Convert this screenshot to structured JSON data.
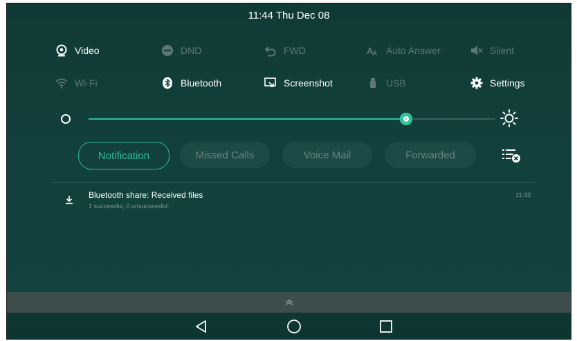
{
  "status": {
    "time": "11:44 Thu Dec 08"
  },
  "quick_settings": {
    "row1": [
      {
        "label": "Video",
        "icon": "video-icon",
        "enabled": true
      },
      {
        "label": "DND",
        "icon": "dnd-icon",
        "enabled": false
      },
      {
        "label": "FWD",
        "icon": "forward-icon",
        "enabled": false
      },
      {
        "label": "Auto Answer",
        "icon": "auto-answer-icon",
        "enabled": false
      },
      {
        "label": "Silent",
        "icon": "silent-icon",
        "enabled": false
      }
    ],
    "row2": [
      {
        "label": "Wi-Fi",
        "icon": "wifi-icon",
        "enabled": false
      },
      {
        "label": "Bluetooth",
        "icon": "bluetooth-icon",
        "enabled": true
      },
      {
        "label": "Screenshot",
        "icon": "screenshot-icon",
        "enabled": true
      },
      {
        "label": "USB",
        "icon": "usb-icon",
        "enabled": false
      },
      {
        "label": "Settings",
        "icon": "settings-icon",
        "enabled": true
      }
    ]
  },
  "brightness": {
    "level": 0.78
  },
  "tabs": [
    {
      "label": "Notification",
      "active": true
    },
    {
      "label": "Missed Calls",
      "active": false
    },
    {
      "label": "Voice Mail",
      "active": false
    },
    {
      "label": "Forwarded",
      "active": false
    }
  ],
  "notifications": [
    {
      "title": "Bluetooth share: Received files",
      "subtitle": "1 successful, 0 unsuccessful.",
      "time": "11:43",
      "icon": "download-icon"
    }
  ],
  "colors": {
    "accent": "#2fbf98",
    "background": "#123f3b",
    "dim_text": "#5d7876"
  }
}
